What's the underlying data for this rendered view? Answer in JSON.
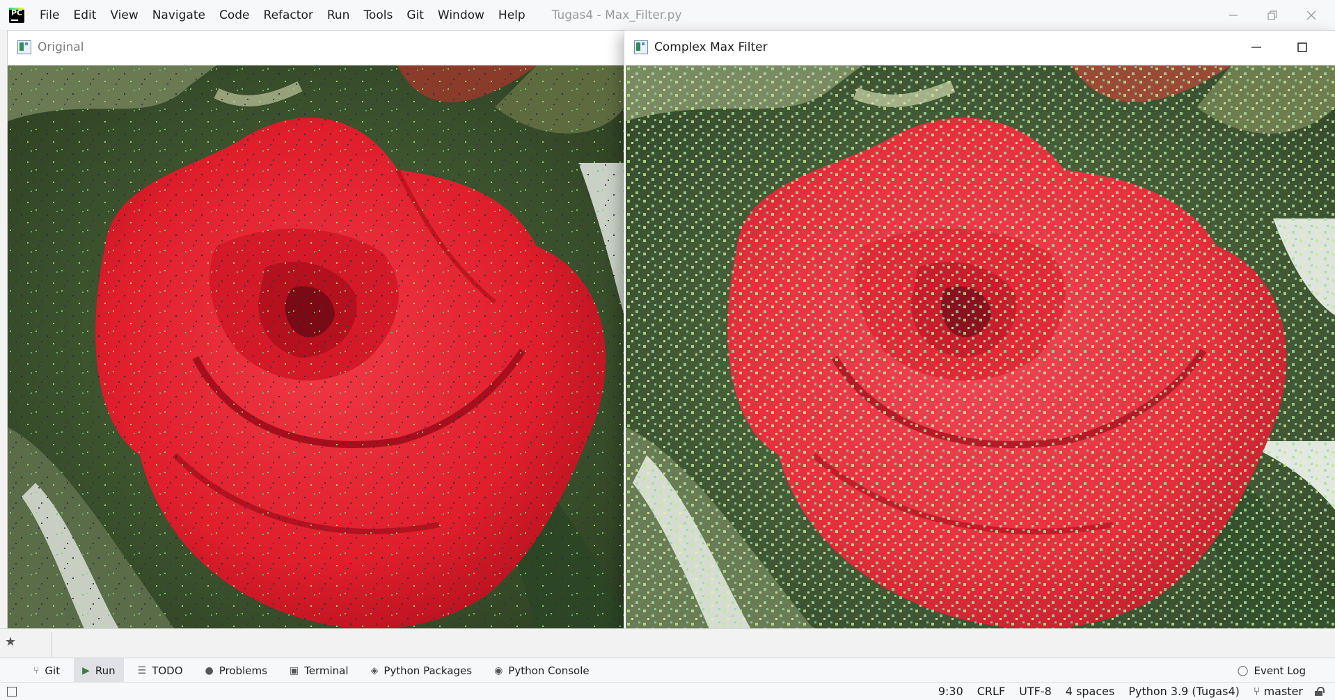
{
  "menubar": {
    "items": [
      "File",
      "Edit",
      "View",
      "Navigate",
      "Code",
      "Refactor",
      "Run",
      "Tools",
      "Git",
      "Window",
      "Help"
    ],
    "title": "Tugas4 - Max_Filter.py"
  },
  "windows": {
    "original": {
      "title": "Original"
    },
    "filtered": {
      "title": "Complex Max Filter"
    }
  },
  "toolwindows": {
    "tabs": [
      "Git",
      "Run",
      "TODO",
      "Problems",
      "Terminal",
      "Python Packages",
      "Python Console"
    ],
    "active": "Run",
    "event_log": "Event Log"
  },
  "statusbar": {
    "position": "9:30",
    "line_sep": "CRLF",
    "encoding": "UTF-8",
    "indent": "4 spaces",
    "interpreter": "Python 3.9 (Tugas4)",
    "branch": "master"
  },
  "colors": {
    "rose": "#e8202f",
    "rose_dark": "#a8101c",
    "leaf": "#3d5a2e",
    "filtered_rose": "#e63a4c"
  }
}
